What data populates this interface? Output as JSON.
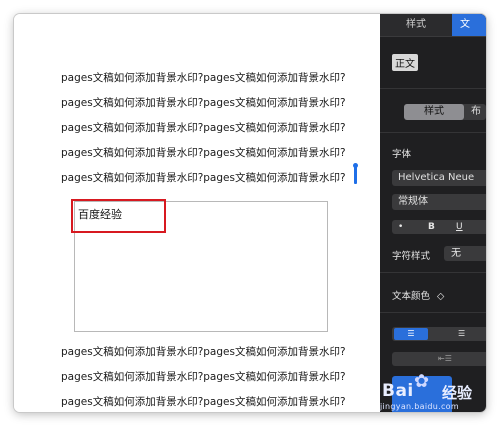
{
  "document": {
    "lines_top": [
      "pages文稿如何添加背景水印?pages文稿如何添加背景水印?",
      "pages文稿如何添加背景水印?pages文稿如何添加背景水印?",
      "pages文稿如何添加背景水印?pages文稿如何添加背景水印?",
      "pages文稿如何添加背景水印?pages文稿如何添加背景水印?",
      "pages文稿如何添加背景水印?pages文稿如何添加背景水印?"
    ],
    "textbox_text": "百度经验",
    "lines_bottom": [
      "pages文稿如何添加背景水印?pages文稿如何添加背景水印?",
      "pages文稿如何添加背景水印?pages文稿如何添加背景水印?",
      "pages文稿如何添加背景水印?pages文稿如何添加背景水印?"
    ],
    "highlight_color": "#d71920",
    "cursor_color": "#1f6fe8"
  },
  "inspector": {
    "tabs": [
      {
        "label": "样式",
        "active": false
      },
      {
        "label": "文",
        "active": true
      }
    ],
    "paragraph_style": "正文",
    "segment": {
      "active": "样式",
      "next": "布"
    },
    "font_label": "字体",
    "font_family": "Helvetica Neue",
    "font_typeface": "常规体",
    "format_buttons": [
      "•",
      "B",
      "U"
    ],
    "char_style_label": "字符样式",
    "char_style_value": "无",
    "text_color_label": "文本颜色",
    "text_color_chevron": "◇",
    "align_left_icon": "align-left-icon",
    "align_center_icon": "align-center-icon",
    "indent_icon": "indent-icon",
    "accent_color": "#2a6fdb",
    "panel_bg": "#1f1f21"
  },
  "watermark": {
    "logo_left": "Bai",
    "logo_paw": "✿",
    "logo_right": "经验",
    "url": "jingyan.baidu.com"
  }
}
